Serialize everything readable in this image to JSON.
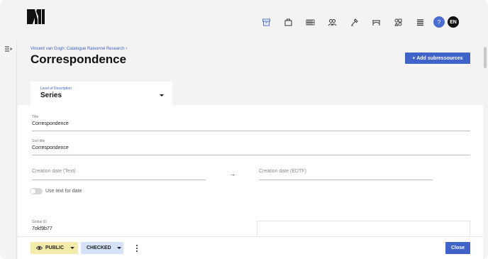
{
  "header": {
    "logo_icon": "logo-icon",
    "nav_icons": [
      "archive-icon",
      "building-icon",
      "records-icon",
      "people-icon",
      "tools-icon",
      "bridge-icon",
      "objects-icon",
      "list-icon"
    ],
    "active_nav_color": "#4a6fd3",
    "help_label": "?",
    "language_label": "EN"
  },
  "breadcrumb": {
    "parent": "Vincent van Gogh: Catalogue Raisonné Research",
    "separator": "›"
  },
  "page": {
    "title": "Correspondence",
    "add_button_label": "+ Add subressources"
  },
  "level_of_description": {
    "label": "Level of Description",
    "value": "Series"
  },
  "form": {
    "title": {
      "label": "Title",
      "value": "Correspondence"
    },
    "sort_title": {
      "label": "Sort title",
      "value": "Correspondence"
    },
    "creation_date_text": {
      "placeholder": "Creation date (Text)"
    },
    "date_arrow": "→",
    "creation_date_edtf": {
      "placeholder": "Creation date (EDTF)"
    },
    "use_text_toggle": {
      "label": "Use text for date",
      "checked": false
    },
    "global_id": {
      "label": "Global ID",
      "value": "7okf9b77"
    }
  },
  "footer": {
    "visibility_label": "PUBLIC",
    "status_label": "CHECKED",
    "close_label": "Close"
  },
  "colors": {
    "primary": "#3f63c9",
    "public_badge": "#f3ebaa",
    "checked_badge": "#d4e1f6",
    "background": "#f4f3f2"
  }
}
